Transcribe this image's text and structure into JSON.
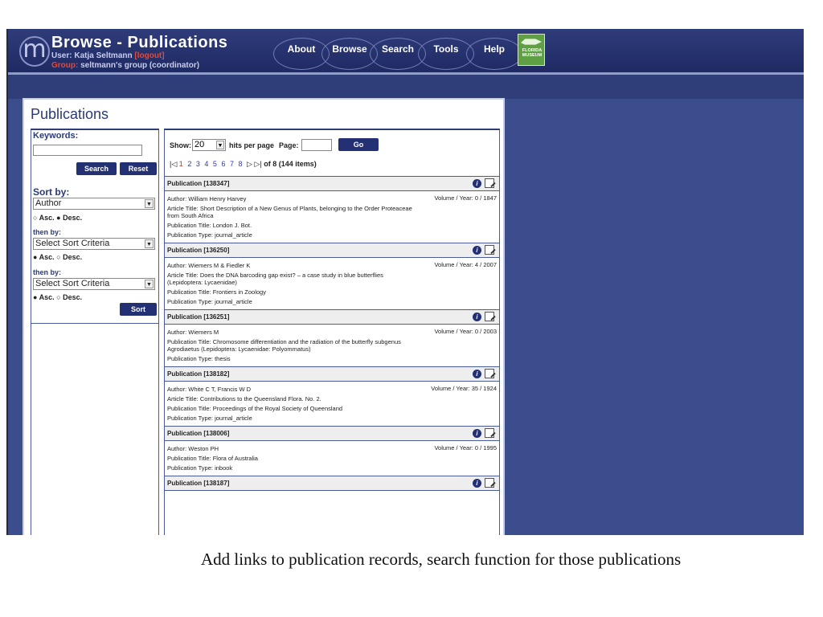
{
  "header": {
    "logo_letter": "m",
    "title": "Browse - Publications",
    "user_label": "User:",
    "user_name": "Katja Seltmann",
    "logout": "[logout]",
    "group_label": "Group:",
    "group_name": "seltmann's group (coordinator)",
    "nav": [
      "About",
      "Browse",
      "Search",
      "Tools",
      "Help"
    ],
    "museum_text": "FLORIDA MUSEUM"
  },
  "panel": {
    "title": "Publications"
  },
  "sidebar": {
    "keywords_label": "Keywords:",
    "keywords_value": "",
    "search_btn": "Search",
    "reset_btn": "Reset",
    "sort_by_label": "Sort by:",
    "sort1_value": "Author",
    "then_by_label": "then by:",
    "sort2_value": "Select Sort Criteria",
    "sort3_value": "Select Sort Criteria",
    "asc": "Asc.",
    "desc": "Desc.",
    "sort_btn": "Sort"
  },
  "controls": {
    "show_label": "Show:",
    "show_value": "20",
    "hits_label": "hits per page",
    "page_label": "Page:",
    "go_btn": "Go",
    "pages": [
      "1",
      "2",
      "3",
      "4",
      "5",
      "6",
      "7",
      "8"
    ],
    "of_text": "of 8",
    "items_text": "(144 items)"
  },
  "publications": [
    {
      "head": "Publication [138347]",
      "lines": [
        "Author: William Henry Harvey",
        "Article Title: Short Description of a New Genus of Plants, belonging to the Order Proteaceae from South Africa",
        "Publication Title: London J. Bot.",
        "Publication Type: journal_article"
      ],
      "vol": "Volume / Year: 0 / 1847"
    },
    {
      "head": "Publication [136250]",
      "lines": [
        "Author: Wiemers M & Fiedler K",
        "Article Title: Does the DNA barcoding gap exist? – a case study in blue butterflies (Lepidoptera: Lycaenidae)",
        "Publication Title: Frontiers in Zoology",
        "Publication Type: journal_article"
      ],
      "vol": "Volume / Year: 4 / 2007"
    },
    {
      "head": "Publication [136251]",
      "lines": [
        "Author: Wiemers M",
        "Publication Title: Chromosome differentiation and the radiation of the butterfly subgenus Agrodiaetus (Lepidoptera: Lycaenidae: Polyommatus)",
        "Publication Type: thesis"
      ],
      "vol": "Volume / Year: 0 / 2003"
    },
    {
      "head": "Publication [138182]",
      "lines": [
        "Author: White C T, Francis W D",
        "Article Title: Contributions to the Queensland Flora. No. 2.",
        "Publication Title: Proceedings of the Royal Society of Queensland",
        "Publication Type: journal_article"
      ],
      "vol": "Volume / Year: 35 / 1924"
    },
    {
      "head": "Publication [138006]",
      "lines": [
        "Author: Weston PH",
        "Publication Title: Flora of Australia",
        "Publication Type: inbook"
      ],
      "vol": "Volume / Year: 0 / 1995"
    },
    {
      "head": "Publication [138187]",
      "lines": [],
      "vol": ""
    }
  ],
  "caption": "Add links to publication records, search function for those publications"
}
